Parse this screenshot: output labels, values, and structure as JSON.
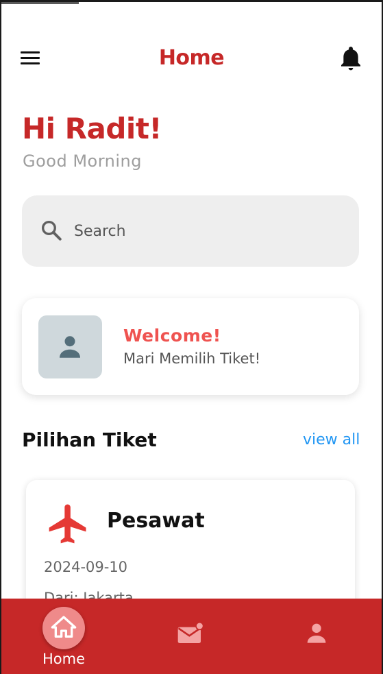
{
  "header": {
    "title": "Home",
    "menu_icon": "hamburger-menu-icon",
    "bell_icon": "bell-icon"
  },
  "greeting": {
    "title": "Hi Radit!",
    "subtitle": "Good Morning"
  },
  "search": {
    "placeholder": "Search",
    "value": "",
    "icon": "search-icon"
  },
  "welcome_card": {
    "title": "Welcome!",
    "text": "Mari Memilih Tiket!",
    "avatar_icon": "person-icon"
  },
  "section": {
    "title": "Pilihan Tiket",
    "view_all": "view all"
  },
  "tickets": [
    {
      "name": "Pesawat",
      "date": "2024-09-10",
      "from": "Dari: Jakarta",
      "icon": "airplane-icon"
    }
  ],
  "bottom_nav": {
    "items": [
      {
        "label": "Home",
        "icon": "home-icon",
        "active": true
      },
      {
        "label": "",
        "icon": "mail-icon",
        "active": false
      },
      {
        "label": "",
        "icon": "person-icon",
        "active": false
      }
    ]
  },
  "colors": {
    "primary": "#c62828",
    "accent": "#ef5350",
    "link": "#2196f3",
    "search_bg": "#eeeeee",
    "avatar_bg": "#cfd8dc"
  }
}
